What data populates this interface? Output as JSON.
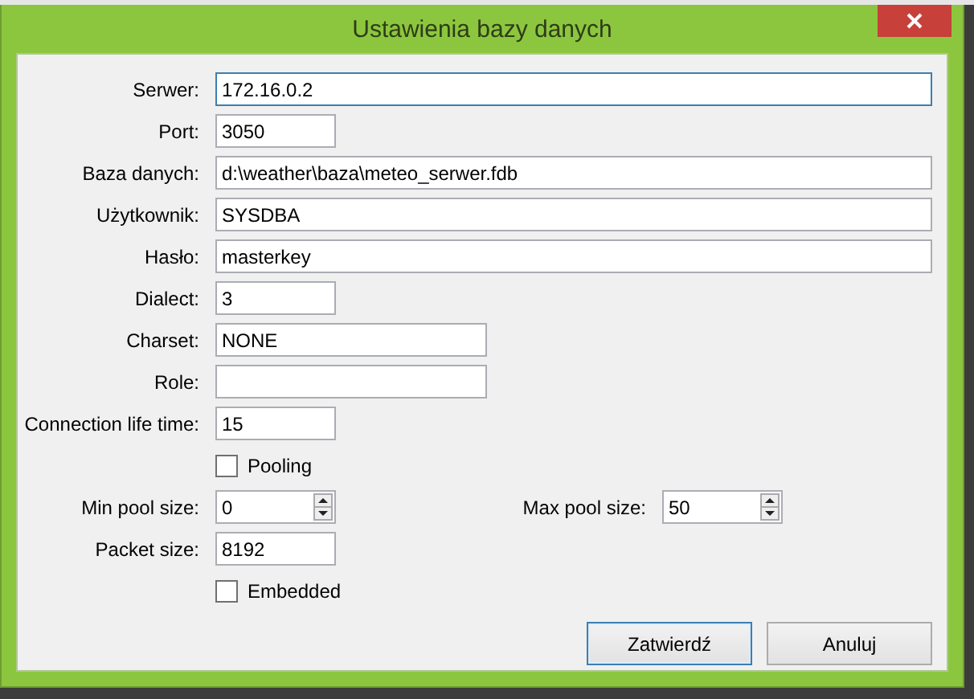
{
  "window": {
    "title": "Ustawienia bazy danych"
  },
  "fields": [
    {
      "kind": "long",
      "label": "Serwer:",
      "value": "172.16.0.2",
      "focused": true
    },
    {
      "kind": "short",
      "label": "Port:",
      "value": "3050",
      "focused": false
    },
    {
      "kind": "long",
      "label": "Baza danych:",
      "value": "d:\\weather\\baza\\meteo_serwer.fdb",
      "focused": false
    },
    {
      "kind": "long",
      "label": "Użytkownik:",
      "value": "SYSDBA",
      "focused": false
    },
    {
      "kind": "long",
      "label": "Hasło:",
      "value": "masterkey",
      "focused": false
    },
    {
      "kind": "short",
      "label": "Dialect:",
      "value": "3",
      "focused": false
    },
    {
      "kind": "medium",
      "label": "Charset:",
      "value": "NONE",
      "focused": false
    },
    {
      "kind": "medium",
      "label": "Role:",
      "focused": false
    },
    {
      "kind": "short",
      "label": "Connection life time:",
      "value": "15",
      "focused": false
    },
    {
      "kind": "checkbox",
      "label": "Pooling",
      "checked": false
    },
    {
      "kind": "spinpair",
      "spinners": [
        {
          "label": "Min pool size:",
          "value": "0"
        },
        {
          "label": "Max pool size:",
          "value": "50"
        }
      ]
    },
    {
      "kind": "short",
      "label": "Packet size:",
      "value": "8192",
      "focused": false
    },
    {
      "kind": "checkbox",
      "label": "Embedded",
      "checked": false
    }
  ],
  "buttons": [
    {
      "label": "Zatwierdź",
      "default": true
    },
    {
      "label": "Anuluj",
      "default": false
    }
  ]
}
